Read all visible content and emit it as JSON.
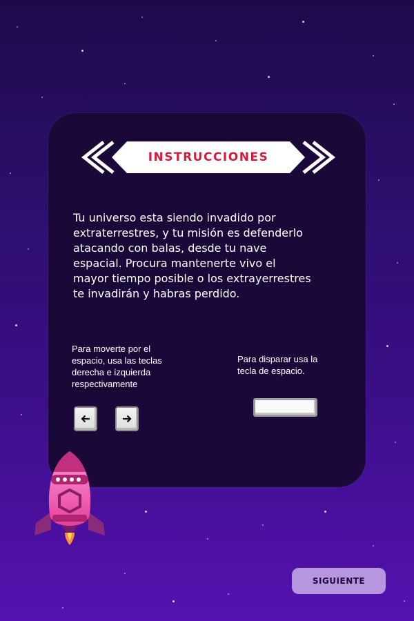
{
  "instructions": {
    "title": "INSTRUCCIONES",
    "story": "Tu universo esta siendo invadido por\nextraterrestres, y tu misión es defenderlo\natacando con balas,  desde tu nave\nespacial. Procura mantenerte vivo el\nmayor tiempo posible o los extrayerrestres\nte invadirán y habras perdido.",
    "move_hint": "Para moverte por el\nespacio, usa las teclas\nderecha e izquierda\nrespectivamente",
    "shoot_hint": "Para disparar usa la\ntecla de espacio."
  },
  "keys": {
    "left_icon": "arrow-left-icon",
    "right_icon": "arrow-right-icon",
    "space_icon": "spacebar-key"
  },
  "colors": {
    "background_top": "#1e0a4a",
    "background_bottom": "#5512b0",
    "panel": "#1a0838",
    "title_red": "#d21d3e",
    "button": "#b796e0",
    "rocket_pink": "#f04fa8"
  },
  "footer": {
    "next_label": "SIGUIENTE"
  }
}
